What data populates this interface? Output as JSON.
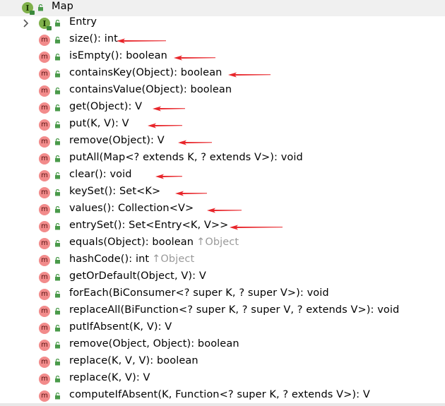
{
  "tree": {
    "root": {
      "label": "Map",
      "icon": "interface-icon"
    },
    "nested": {
      "label": "Entry",
      "icon": "interface-icon"
    },
    "methods": [
      {
        "signature": "size(): int",
        "arrow": true
      },
      {
        "signature": "isEmpty(): boolean",
        "arrow": true
      },
      {
        "signature": "containsKey(Object): boolean",
        "arrow": true
      },
      {
        "signature": "containsValue(Object): boolean",
        "arrow": false
      },
      {
        "signature": "get(Object): V",
        "arrow": true
      },
      {
        "signature": "put(K, V): V",
        "arrow": true
      },
      {
        "signature": "remove(Object): V",
        "arrow": true
      },
      {
        "signature": "putAll(Map<? extends K, ? extends V>): void",
        "arrow": false
      },
      {
        "signature": "clear(): void",
        "arrow": true
      },
      {
        "signature": "keySet(): Set<K>",
        "arrow": true
      },
      {
        "signature": "values(): Collection<V>",
        "arrow": true
      },
      {
        "signature": "entrySet(): Set<Entry<K, V>>",
        "arrow": true
      },
      {
        "signature": "equals(Object): boolean",
        "inherited": "↑Object",
        "arrow": false
      },
      {
        "signature": "hashCode(): int",
        "inherited": "↑Object",
        "arrow": false
      },
      {
        "signature": "getOrDefault(Object, V): V",
        "arrow": false
      },
      {
        "signature": "forEach(BiConsumer<? super K, ? super V>): void",
        "arrow": false
      },
      {
        "signature": "replaceAll(BiFunction<? super K, ? super V, ? extends V>): void",
        "arrow": false
      },
      {
        "signature": "putIfAbsent(K, V): V",
        "arrow": false
      },
      {
        "signature": "remove(Object, Object): boolean",
        "arrow": false
      },
      {
        "signature": "replace(K, V, V): boolean",
        "arrow": false
      },
      {
        "signature": "replace(K, V): V",
        "arrow": false
      },
      {
        "signature": "computeIfAbsent(K, Function<? super K, ? extends V>): V",
        "arrow": false
      }
    ],
    "method_icon_letter": "m",
    "interface_icon_letter": "I"
  },
  "colors": {
    "method_icon": "#f28b8b",
    "interface_icon": "#7fb04a",
    "arrow": "#e8262b",
    "inherited_text": "#9a9a9a",
    "root_row_bg": "#f0f0f0"
  }
}
